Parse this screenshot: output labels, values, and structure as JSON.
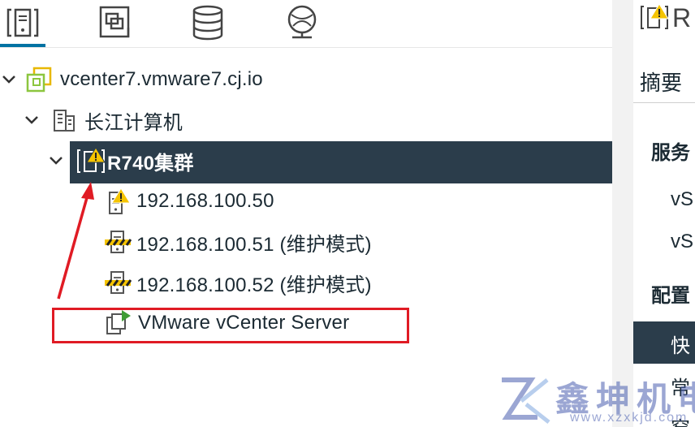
{
  "tabs": [
    {
      "icon": "hosts-clusters-icon",
      "active": true
    },
    {
      "icon": "vms-templates-icon",
      "active": false
    },
    {
      "icon": "storage-icon",
      "active": false
    },
    {
      "icon": "networking-icon",
      "active": false
    }
  ],
  "tree": {
    "vcenter": {
      "label": "vcenter7.vmware7.cj.io",
      "icon": "vcenter-icon"
    },
    "datacenter": {
      "label": "长江计算机",
      "icon": "datacenter-icon"
    },
    "cluster": {
      "label": "R740集群",
      "icon": "cluster-warning-icon"
    },
    "hosts": [
      {
        "label": "192.168.100.50",
        "icon": "host-warning-icon"
      },
      {
        "label": "192.168.100.51 (维护模式)",
        "icon": "host-maintenance-icon"
      },
      {
        "label": "192.168.100.52 (维护模式)",
        "icon": "host-maintenance-icon"
      }
    ],
    "vm": {
      "label": "VMware vCenter Server",
      "icon": "vm-powered-on-icon"
    }
  },
  "right_panel": {
    "title_fragment": "R",
    "tab_summary": "摘要",
    "section_services": "服务",
    "item1": "vS",
    "item2": "vS",
    "section_config": "配置",
    "active_item": "快",
    "item3": "常",
    "item4": "窑"
  },
  "watermark": {
    "text": "鑫坤机电",
    "url": "www.xzxkjd.com"
  },
  "colors": {
    "selected_bg": "#2b3d4b",
    "accent": "#0072a3",
    "warning": "#f5c400",
    "annotation": "#e01b24"
  }
}
